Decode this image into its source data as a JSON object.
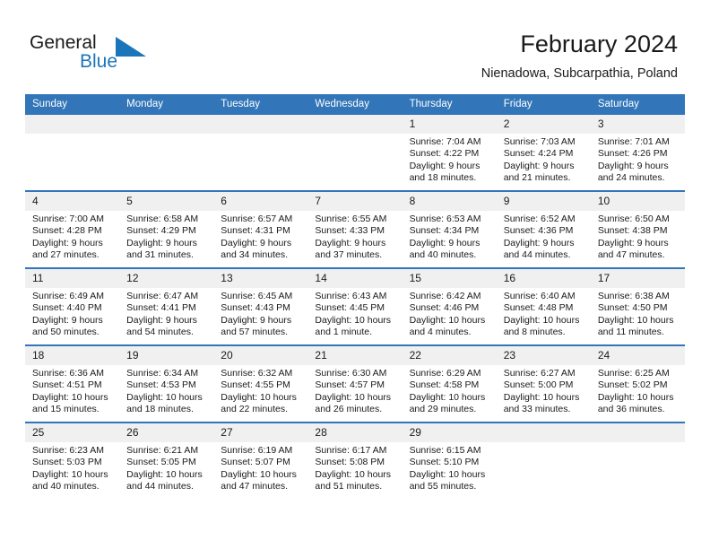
{
  "brand": {
    "name_part1": "General",
    "name_part2": "Blue",
    "triangle_icon": "triangle-icon",
    "accent_color": "#1b75bb"
  },
  "header": {
    "title": "February 2024",
    "subtitle": "Nienadowa, Subcarpathia, Poland"
  },
  "theme": {
    "header_bar_color": "#3275b8",
    "daynum_strip_color": "#f0f0f0",
    "text_color": "#1a1a1a",
    "cell_background": "#ffffff"
  },
  "calendar": {
    "weekday_headers": [
      "Sunday",
      "Monday",
      "Tuesday",
      "Wednesday",
      "Thursday",
      "Friday",
      "Saturday"
    ],
    "weeks": [
      [
        {
          "day": "",
          "empty": true
        },
        {
          "day": "",
          "empty": true
        },
        {
          "day": "",
          "empty": true
        },
        {
          "day": "",
          "empty": true
        },
        {
          "day": "1",
          "sunrise": "Sunrise: 7:04 AM",
          "sunset": "Sunset: 4:22 PM",
          "daylight": "Daylight: 9 hours and 18 minutes."
        },
        {
          "day": "2",
          "sunrise": "Sunrise: 7:03 AM",
          "sunset": "Sunset: 4:24 PM",
          "daylight": "Daylight: 9 hours and 21 minutes."
        },
        {
          "day": "3",
          "sunrise": "Sunrise: 7:01 AM",
          "sunset": "Sunset: 4:26 PM",
          "daylight": "Daylight: 9 hours and 24 minutes."
        }
      ],
      [
        {
          "day": "4",
          "sunrise": "Sunrise: 7:00 AM",
          "sunset": "Sunset: 4:28 PM",
          "daylight": "Daylight: 9 hours and 27 minutes."
        },
        {
          "day": "5",
          "sunrise": "Sunrise: 6:58 AM",
          "sunset": "Sunset: 4:29 PM",
          "daylight": "Daylight: 9 hours and 31 minutes."
        },
        {
          "day": "6",
          "sunrise": "Sunrise: 6:57 AM",
          "sunset": "Sunset: 4:31 PM",
          "daylight": "Daylight: 9 hours and 34 minutes."
        },
        {
          "day": "7",
          "sunrise": "Sunrise: 6:55 AM",
          "sunset": "Sunset: 4:33 PM",
          "daylight": "Daylight: 9 hours and 37 minutes."
        },
        {
          "day": "8",
          "sunrise": "Sunrise: 6:53 AM",
          "sunset": "Sunset: 4:34 PM",
          "daylight": "Daylight: 9 hours and 40 minutes."
        },
        {
          "day": "9",
          "sunrise": "Sunrise: 6:52 AM",
          "sunset": "Sunset: 4:36 PM",
          "daylight": "Daylight: 9 hours and 44 minutes."
        },
        {
          "day": "10",
          "sunrise": "Sunrise: 6:50 AM",
          "sunset": "Sunset: 4:38 PM",
          "daylight": "Daylight: 9 hours and 47 minutes."
        }
      ],
      [
        {
          "day": "11",
          "sunrise": "Sunrise: 6:49 AM",
          "sunset": "Sunset: 4:40 PM",
          "daylight": "Daylight: 9 hours and 50 minutes."
        },
        {
          "day": "12",
          "sunrise": "Sunrise: 6:47 AM",
          "sunset": "Sunset: 4:41 PM",
          "daylight": "Daylight: 9 hours and 54 minutes."
        },
        {
          "day": "13",
          "sunrise": "Sunrise: 6:45 AM",
          "sunset": "Sunset: 4:43 PM",
          "daylight": "Daylight: 9 hours and 57 minutes."
        },
        {
          "day": "14",
          "sunrise": "Sunrise: 6:43 AM",
          "sunset": "Sunset: 4:45 PM",
          "daylight": "Daylight: 10 hours and 1 minute."
        },
        {
          "day": "15",
          "sunrise": "Sunrise: 6:42 AM",
          "sunset": "Sunset: 4:46 PM",
          "daylight": "Daylight: 10 hours and 4 minutes."
        },
        {
          "day": "16",
          "sunrise": "Sunrise: 6:40 AM",
          "sunset": "Sunset: 4:48 PM",
          "daylight": "Daylight: 10 hours and 8 minutes."
        },
        {
          "day": "17",
          "sunrise": "Sunrise: 6:38 AM",
          "sunset": "Sunset: 4:50 PM",
          "daylight": "Daylight: 10 hours and 11 minutes."
        }
      ],
      [
        {
          "day": "18",
          "sunrise": "Sunrise: 6:36 AM",
          "sunset": "Sunset: 4:51 PM",
          "daylight": "Daylight: 10 hours and 15 minutes."
        },
        {
          "day": "19",
          "sunrise": "Sunrise: 6:34 AM",
          "sunset": "Sunset: 4:53 PM",
          "daylight": "Daylight: 10 hours and 18 minutes."
        },
        {
          "day": "20",
          "sunrise": "Sunrise: 6:32 AM",
          "sunset": "Sunset: 4:55 PM",
          "daylight": "Daylight: 10 hours and 22 minutes."
        },
        {
          "day": "21",
          "sunrise": "Sunrise: 6:30 AM",
          "sunset": "Sunset: 4:57 PM",
          "daylight": "Daylight: 10 hours and 26 minutes."
        },
        {
          "day": "22",
          "sunrise": "Sunrise: 6:29 AM",
          "sunset": "Sunset: 4:58 PM",
          "daylight": "Daylight: 10 hours and 29 minutes."
        },
        {
          "day": "23",
          "sunrise": "Sunrise: 6:27 AM",
          "sunset": "Sunset: 5:00 PM",
          "daylight": "Daylight: 10 hours and 33 minutes."
        },
        {
          "day": "24",
          "sunrise": "Sunrise: 6:25 AM",
          "sunset": "Sunset: 5:02 PM",
          "daylight": "Daylight: 10 hours and 36 minutes."
        }
      ],
      [
        {
          "day": "25",
          "sunrise": "Sunrise: 6:23 AM",
          "sunset": "Sunset: 5:03 PM",
          "daylight": "Daylight: 10 hours and 40 minutes."
        },
        {
          "day": "26",
          "sunrise": "Sunrise: 6:21 AM",
          "sunset": "Sunset: 5:05 PM",
          "daylight": "Daylight: 10 hours and 44 minutes."
        },
        {
          "day": "27",
          "sunrise": "Sunrise: 6:19 AM",
          "sunset": "Sunset: 5:07 PM",
          "daylight": "Daylight: 10 hours and 47 minutes."
        },
        {
          "day": "28",
          "sunrise": "Sunrise: 6:17 AM",
          "sunset": "Sunset: 5:08 PM",
          "daylight": "Daylight: 10 hours and 51 minutes."
        },
        {
          "day": "29",
          "sunrise": "Sunrise: 6:15 AM",
          "sunset": "Sunset: 5:10 PM",
          "daylight": "Daylight: 10 hours and 55 minutes."
        },
        {
          "day": "",
          "empty": true
        },
        {
          "day": "",
          "empty": true
        }
      ]
    ]
  }
}
